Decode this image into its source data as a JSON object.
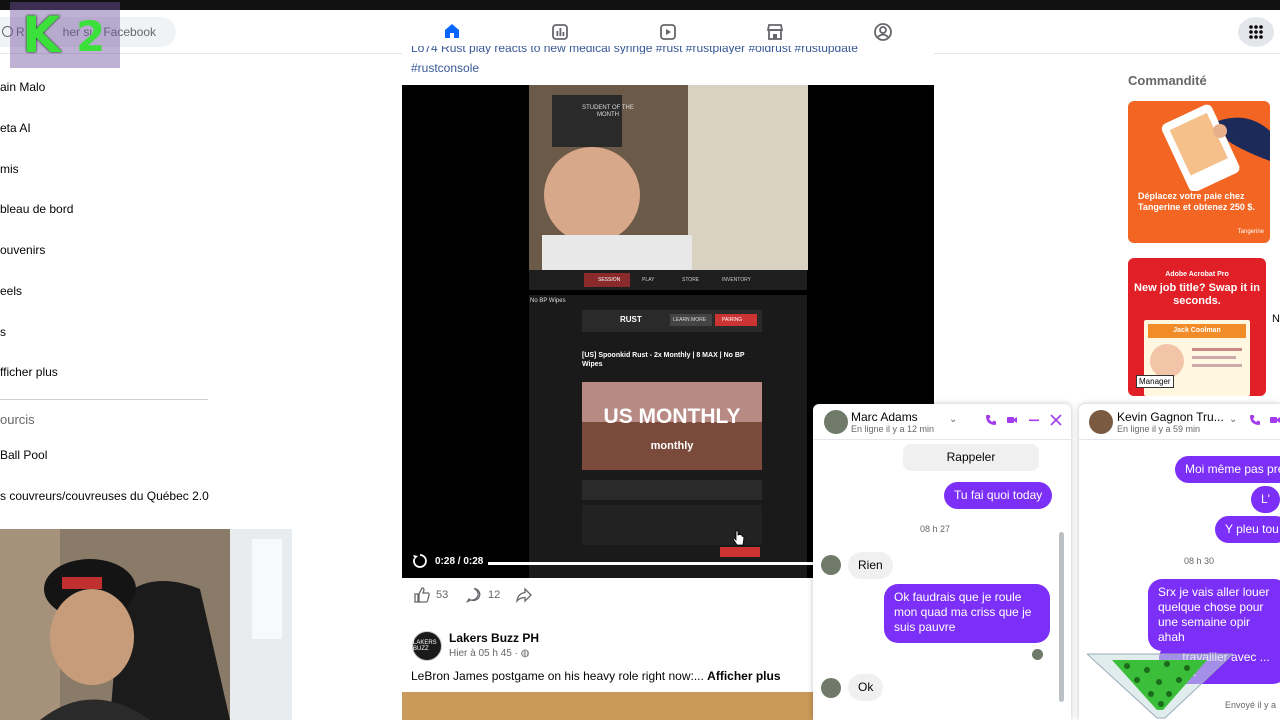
{
  "header": {
    "search_placeholder": "Rechercher sur Facebook",
    "search_visible_prefix": "R",
    "search_visible_suffix": "her sur Facebook"
  },
  "overlay_logo": {
    "letter": "K",
    "number": "2"
  },
  "left_nav": {
    "items": [
      "ain Malo",
      "eta AI",
      "mis",
      "bleau de bord",
      "ouvenirs",
      "eels",
      "s",
      "fficher plus"
    ],
    "section_title": "ourcis",
    "shortcuts": [
      "Ball Pool",
      "s couvreurs/couvreuses du Québec 2.0"
    ]
  },
  "post1": {
    "hashtags_line1": "Lo74 Rust play reacts to new medical syringe #rust #rustplayer #oldrust #rustupdate",
    "hashtags_line2": "#rustconsole",
    "video_time": "0:28 / 0:28",
    "progress": 1.0,
    "likes": "53",
    "comments": "12",
    "video_overlay": {
      "poster_text": "STUDENT OF THE MONTH",
      "menu": [
        "SESSION",
        "PLAY",
        "STORE",
        "INVENTORY"
      ],
      "server_tag": "No BP Wipes",
      "logo": "RUST",
      "learn_more": "LEARN MORE",
      "pairing": "PAIRING",
      "server_title": "[US] Spoonkid Rust - 2x Monthly | 8 MAX | No BP Wipes",
      "banner_big": "US MONTHLY",
      "banner_small": "monthly"
    }
  },
  "post2": {
    "page_name": "Lakers Buzz PH",
    "avatar_text": "LAKERS BUZZ",
    "time": "Hier à 05 h 45 · ",
    "text": "LeBron James postgame on his heavy role right now:... ",
    "more": "Afficher plus"
  },
  "sponsored": {
    "title": "Commandité",
    "ad1_text": "Déplacez votre paie chez Tangerine et obtenez 250 $.",
    "ad1_brand": "Tangerine",
    "ad2_brand": "Adobe Acrobat Pro",
    "ad2_text": "New job title? Swap it in seconds.",
    "ad2_doc_name": "Jack Coolman",
    "ad2_tag": "Manager",
    "partial_letter": "N"
  },
  "chat1": {
    "name": "Marc Adams",
    "status": "En ligne il y a 12 min",
    "messages": {
      "callback": "Rappeler",
      "out1": "Tu fai quoi today",
      "time1": "08 h 27",
      "in1": "Rien",
      "out2": "Ok faudrais que je roule mon quad ma criss que je suis pauvre",
      "in2": "Ok"
    }
  },
  "chat2": {
    "name": "Kevin Gagnon Tru...",
    "status": "En ligne il y a 59 min",
    "messages": {
      "out1": "Moi même pas pre",
      "out2": "L'",
      "out3": "Y pleu tou",
      "time1": "08 h 30",
      "out4": "Srx je vais aller louer quelque chose pour une semaine opir ahah",
      "out5": "... travailler avec ... trava"
    },
    "sent": "Envoyé il y a"
  },
  "colors": {
    "fb_blue": "#0866ff",
    "messenger_purple": "#7b2ff7",
    "ad_orange": "#f26522",
    "ad_red": "#e11f26"
  }
}
